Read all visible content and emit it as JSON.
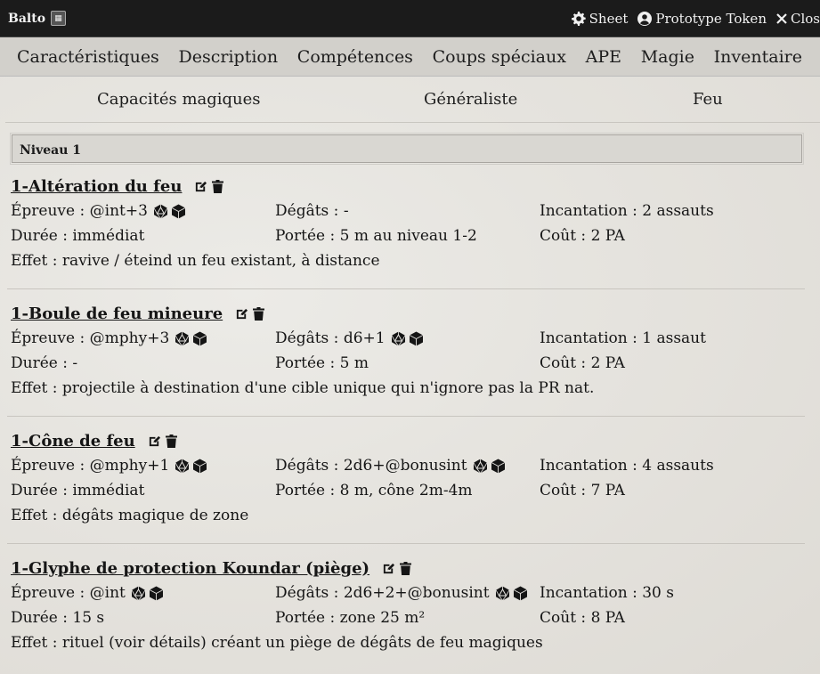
{
  "window": {
    "title": "Balto",
    "sheet_label": "Sheet",
    "token_label": "Prototype Token",
    "close_label": "Clos"
  },
  "tabs": [
    "Caractéristiques",
    "Description",
    "Compétences",
    "Coups spéciaux",
    "APE",
    "Magie",
    "Inventaire"
  ],
  "subtabs": [
    "Capacités magiques",
    "Généraliste",
    "Feu"
  ],
  "level_header": "Niveau 1",
  "labels": {
    "epreuve": "Épreuve :",
    "degats": "Dégâts :",
    "incantation": "Incantation :",
    "duree": "Durée :",
    "portee": "Portée :",
    "cout": "Coût :",
    "effet": "Effet :"
  },
  "spells": [
    {
      "name": "1-Altération du feu",
      "epreuve": "@int+3",
      "degats": "-",
      "incantation": "2 assauts",
      "duree": "immédiat",
      "portee": "5 m au niveau 1-2",
      "cout": "2 PA",
      "effet": "ravive / éteind un feu existant, à distance",
      "degats_has_dice": false
    },
    {
      "name": "1-Boule de feu mineure",
      "epreuve": "@mphy+3",
      "degats": "d6+1",
      "incantation": "1 assaut",
      "duree": "-",
      "portee": "5 m",
      "cout": "2 PA",
      "effet": "projectile à destination d'une cible unique qui n'ignore pas la PR nat.",
      "degats_has_dice": true
    },
    {
      "name": "1-Cône de feu",
      "epreuve": "@mphy+1",
      "degats": "2d6+@bonusint",
      "incantation": "4 assauts",
      "duree": "immédiat",
      "portee": "8 m, cône 2m-4m",
      "cout": "7 PA",
      "effet": "dégâts magique de zone",
      "degats_has_dice": true
    },
    {
      "name": "1-Glyphe de protection Koundar (piège)",
      "epreuve": "@int",
      "degats": "2d6+2+@bonusint",
      "incantation": "30 s",
      "duree": "15 s",
      "portee": "zone 25 m²",
      "cout": "8 PA",
      "effet": "rituel (voir détails) créant un piège de dégâts de feu magiques",
      "degats_has_dice": true
    }
  ]
}
